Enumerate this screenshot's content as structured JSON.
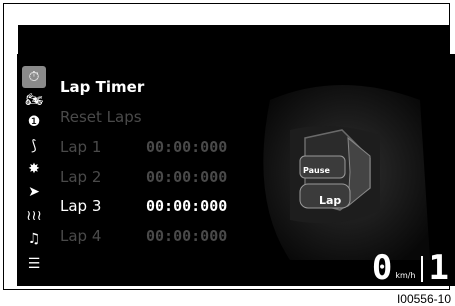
{
  "sidebar": {
    "items": [
      {
        "icon": "stopwatch-icon",
        "glyph": "⏱",
        "active": true
      },
      {
        "icon": "motorcycle-icon",
        "glyph": "🏍",
        "active": false
      },
      {
        "icon": "info-icon",
        "glyph": "❶",
        "active": false
      },
      {
        "icon": "speedometer-icon",
        "glyph": "⟆",
        "active": false
      },
      {
        "icon": "settings-gear-icon",
        "glyph": "✸",
        "active": false
      },
      {
        "icon": "navigation-arrow-icon",
        "glyph": "➤",
        "active": false
      },
      {
        "icon": "heated-grips-icon",
        "glyph": "≀≀≀",
        "active": false
      },
      {
        "icon": "music-note-icon",
        "glyph": "♫",
        "active": false
      },
      {
        "icon": "sliders-icon",
        "glyph": "☰",
        "active": false
      }
    ]
  },
  "menu": {
    "title": "Lap Timer",
    "reset": "Reset Laps",
    "laps": [
      {
        "label": "Lap 1",
        "time": "00:00:000",
        "selected": false
      },
      {
        "label": "Lap 2",
        "time": "00:00:000",
        "selected": false
      },
      {
        "label": "Lap 3",
        "time": "00:00:000",
        "selected": true
      },
      {
        "label": "Lap 4",
        "time": "00:00:000",
        "selected": false
      }
    ]
  },
  "controller": {
    "pause_label": "Pause",
    "lap_label": "Lap"
  },
  "status": {
    "speed": "0",
    "unit": "km/h",
    "gear": "1"
  },
  "reference": "I00556-10"
}
